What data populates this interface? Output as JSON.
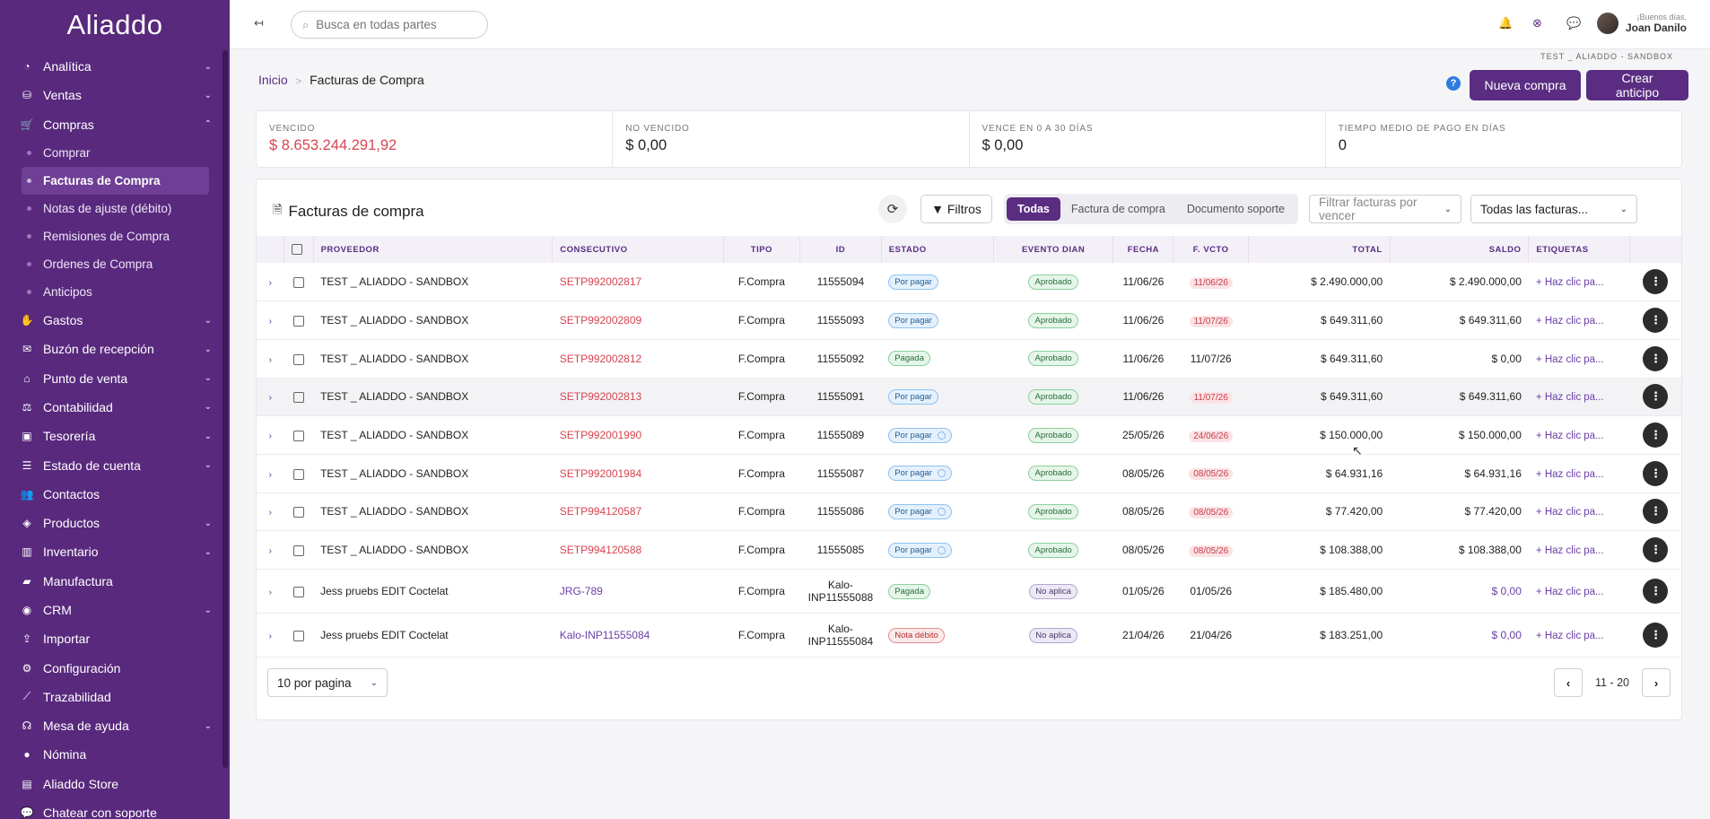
{
  "app": {
    "logo_text": "Aliaddo"
  },
  "sidebar": {
    "items": [
      {
        "label": "Analítica",
        "icon": "dashboard-icon",
        "glyph": "◔",
        "chevron": "⌄"
      },
      {
        "label": "Ventas",
        "icon": "money-bag-icon",
        "glyph": "⛁",
        "chevron": "⌄"
      },
      {
        "label": "Compras",
        "icon": "cart-icon",
        "glyph": "🛒",
        "chevron": "⌃"
      }
    ],
    "compras_sub": [
      "Comprar",
      "Facturas de Compra",
      "Notas de ajuste (débito)",
      "Remisiones de Compra",
      "Ordenes de Compra",
      "Anticipos"
    ],
    "items_after": [
      {
        "label": "Gastos",
        "icon": "hand-coin-icon",
        "glyph": "✋",
        "chevron": "⌄"
      },
      {
        "label": "Buzón de recepción",
        "icon": "inbox-icon",
        "glyph": "✉",
        "chevron": "⌄"
      },
      {
        "label": "Punto de venta",
        "icon": "store-icon",
        "glyph": "⌂",
        "chevron": "⌄"
      },
      {
        "label": "Contabilidad",
        "icon": "scale-icon",
        "glyph": "⚖",
        "chevron": "⌄"
      },
      {
        "label": "Tesorería",
        "icon": "vault-icon",
        "glyph": "▣",
        "chevron": "⌄"
      },
      {
        "label": "Estado de cuenta",
        "icon": "list-icon",
        "glyph": "☰",
        "chevron": "⌄"
      },
      {
        "label": "Contactos",
        "icon": "users-icon",
        "glyph": "👥",
        "chevron": ""
      },
      {
        "label": "Productos",
        "icon": "tags-icon",
        "glyph": "◈",
        "chevron": "⌄"
      },
      {
        "label": "Inventario",
        "icon": "chart-bar-icon",
        "glyph": "▥",
        "chevron": "⌄"
      },
      {
        "label": "Manufactura",
        "icon": "industry-icon",
        "glyph": "▰",
        "chevron": ""
      },
      {
        "label": "CRM",
        "icon": "crm-icon",
        "glyph": "◉",
        "chevron": "⌄"
      },
      {
        "label": "Importar",
        "icon": "upload-icon",
        "glyph": "⇪",
        "chevron": ""
      },
      {
        "label": "Configuración",
        "icon": "gears-icon",
        "glyph": "⚙",
        "chevron": ""
      },
      {
        "label": "Trazabilidad",
        "icon": "trace-icon",
        "glyph": "⟋",
        "chevron": ""
      },
      {
        "label": "Mesa de ayuda",
        "icon": "headset-icon",
        "glyph": "☊",
        "chevron": "⌄"
      },
      {
        "label": "Nómina",
        "icon": "user-icon",
        "glyph": "●",
        "chevron": ""
      },
      {
        "label": "Aliaddo Store",
        "icon": "shop-icon",
        "glyph": "▤",
        "chevron": ""
      },
      {
        "label": "Chatear con soporte",
        "icon": "chat-icon",
        "glyph": "💬",
        "chevron": ""
      }
    ]
  },
  "topbar": {
    "search_placeholder": "Busca en todas partes",
    "greeting": "¡Buenos días,",
    "user_name": "Joan Danilo"
  },
  "page": {
    "env_tag": "TEST _ ALIADDO - SANDBOX",
    "breadcrumb_home": "Inicio",
    "breadcrumb_sep": ">",
    "breadcrumb_current": "Facturas de Compra",
    "help_label": "?",
    "btn_new": "Nueva compra",
    "btn_advance": "Crear anticipo"
  },
  "kpis": [
    {
      "label": "VENCIDO",
      "value": "$ 8.653.244.291,92",
      "accent": "#d64550"
    },
    {
      "label": "NO VENCIDO",
      "value": "$ 0,00"
    },
    {
      "label": "VENCE EN 0 A 30 DÍAS",
      "value": "$ 0,00"
    },
    {
      "label": "TIEMPO MEDIO DE PAGO EN DÍAS",
      "value": "0"
    }
  ],
  "card": {
    "title": "Facturas de compra",
    "filters_label": "Filtros",
    "segments": [
      "Todas",
      "Factura de compra",
      "Documento soporte"
    ],
    "select_due": "Filtrar facturas por vencer",
    "select_all": "Todas las facturas..."
  },
  "table": {
    "headers": [
      "PROVEEDOR",
      "CONSECUTIVO",
      "TIPO",
      "ID",
      "ESTADO",
      "EVENTO DIAN",
      "FECHA",
      "F. VCTO",
      "TOTAL",
      "SALDO",
      "ETIQUETAS"
    ],
    "tag_link": "+ Haz clic pa...",
    "rows": [
      {
        "proveedor": "TEST _ ALIADDO - SANDBOX",
        "consecutivo": "SETP992002817",
        "tipo": "F.Compra",
        "id": "11555094",
        "estado": "Por pagar",
        "estado_kind": "blue",
        "spin": false,
        "evento": "Aprobado",
        "evento_kind": "green",
        "fecha": "11/06/26",
        "vcto": "11/06/26",
        "vcto_red": true,
        "total": "$ 2.490.000,00",
        "saldo": "$ 2.490.000,00",
        "saldo_purple": false
      },
      {
        "proveedor": "TEST _ ALIADDO - SANDBOX",
        "consecutivo": "SETP992002809",
        "tipo": "F.Compra",
        "id": "11555093",
        "estado": "Por pagar",
        "estado_kind": "blue",
        "spin": false,
        "evento": "Aprobado",
        "evento_kind": "green",
        "fecha": "11/06/26",
        "vcto": "11/07/26",
        "vcto_red": true,
        "total": "$ 649.311,60",
        "saldo": "$ 649.311,60",
        "saldo_purple": false
      },
      {
        "proveedor": "TEST _ ALIADDO - SANDBOX",
        "consecutivo": "SETP992002812",
        "tipo": "F.Compra",
        "id": "11555092",
        "estado": "Pagada",
        "estado_kind": "green",
        "spin": false,
        "evento": "Aprobado",
        "evento_kind": "green",
        "fecha": "11/06/26",
        "vcto": "11/07/26",
        "vcto_red": false,
        "total": "$ 649.311,60",
        "saldo": "$ 0,00",
        "saldo_purple": false
      },
      {
        "proveedor": "TEST _ ALIADDO - SANDBOX",
        "consecutivo": "SETP992002813",
        "tipo": "F.Compra",
        "id": "11555091",
        "estado": "Por pagar",
        "estado_kind": "blue",
        "spin": false,
        "evento": "Aprobado",
        "evento_kind": "green",
        "fecha": "11/06/26",
        "vcto": "11/07/26",
        "vcto_red": true,
        "total": "$ 649.311,60",
        "saldo": "$ 649.311,60",
        "saldo_purple": false
      },
      {
        "proveedor": "TEST _ ALIADDO - SANDBOX",
        "consecutivo": "SETP992001990",
        "tipo": "F.Compra",
        "id": "11555089",
        "estado": "Por pagar",
        "estado_kind": "blue",
        "spin": true,
        "evento": "Aprobado",
        "evento_kind": "green",
        "fecha": "25/05/26",
        "vcto": "24/06/26",
        "vcto_red": true,
        "total": "$ 150.000,00",
        "saldo": "$ 150.000,00",
        "saldo_purple": false
      },
      {
        "proveedor": "TEST _ ALIADDO - SANDBOX",
        "consecutivo": "SETP992001984",
        "tipo": "F.Compra",
        "id": "11555087",
        "estado": "Por pagar",
        "estado_kind": "blue",
        "spin": true,
        "evento": "Aprobado",
        "evento_kind": "green",
        "fecha": "08/05/26",
        "vcto": "08/05/26",
        "vcto_red": true,
        "total": "$ 64.931,16",
        "saldo": "$ 64.931,16",
        "saldo_purple": false
      },
      {
        "proveedor": "TEST _ ALIADDO - SANDBOX",
        "consecutivo": "SETP994120587",
        "tipo": "F.Compra",
        "id": "11555086",
        "estado": "Por pagar",
        "estado_kind": "blue",
        "spin": true,
        "evento": "Aprobado",
        "evento_kind": "green",
        "fecha": "08/05/26",
        "vcto": "08/05/26",
        "vcto_red": true,
        "total": "$ 77.420,00",
        "saldo": "$ 77.420,00",
        "saldo_purple": false
      },
      {
        "proveedor": "TEST _ ALIADDO - SANDBOX",
        "consecutivo": "SETP994120588",
        "tipo": "F.Compra",
        "id": "11555085",
        "estado": "Por pagar",
        "estado_kind": "blue",
        "spin": true,
        "evento": "Aprobado",
        "evento_kind": "green",
        "fecha": "08/05/26",
        "vcto": "08/05/26",
        "vcto_red": true,
        "total": "$ 108.388,00",
        "saldo": "$ 108.388,00",
        "saldo_purple": false
      },
      {
        "proveedor": "Jess pruebs EDIT Coctelat",
        "consecutivo": "JRG-789",
        "tipo": "F.Compra",
        "id": "Kalo-INP11555088",
        "estado": "Pagada",
        "estado_kind": "green",
        "spin": false,
        "evento": "No aplica",
        "evento_kind": "gray",
        "fecha": "01/05/26",
        "vcto": "01/05/26",
        "vcto_red": false,
        "total": "$ 185.480,00",
        "saldo": "$ 0,00",
        "saldo_purple": true
      },
      {
        "proveedor": "Jess pruebs EDIT Coctelat",
        "consecutivo": "Kalo-INP11555084",
        "tipo": "F.Compra",
        "id": "Kalo-INP11555084",
        "estado": "Nota débito",
        "estado_kind": "red",
        "spin": false,
        "evento": "No aplica",
        "evento_kind": "gray",
        "fecha": "21/04/26",
        "vcto": "21/04/26",
        "vcto_red": false,
        "total": "$ 183.251,00",
        "saldo": "$ 0,00",
        "saldo_purple": true
      }
    ]
  },
  "pagination": {
    "per_page": "10 por pagina",
    "range": "11 - 20",
    "prev": "‹",
    "next": "›"
  },
  "colors": {
    "sidebar": "#58297d",
    "primary": "#5a2d82",
    "danger": "#d64550"
  }
}
